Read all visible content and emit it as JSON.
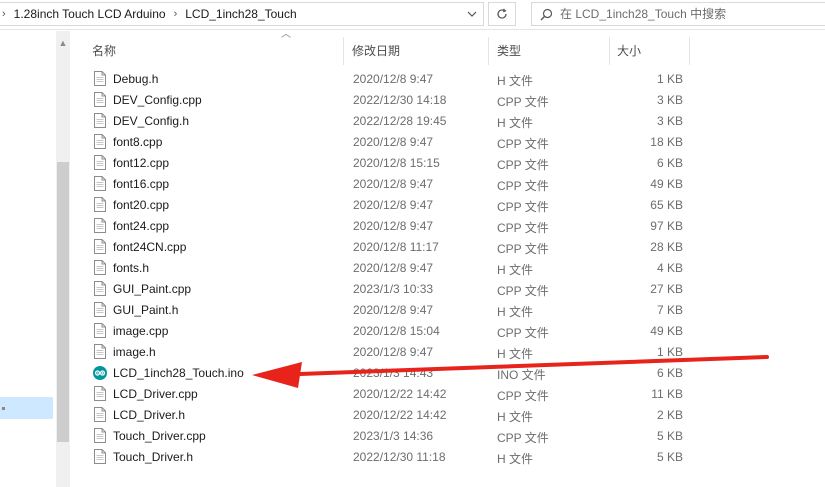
{
  "address": {
    "crumbs": [
      "1.28inch Touch LCD Arduino",
      "LCD_1inch28_Touch"
    ]
  },
  "search": {
    "placeholder": "在 LCD_1inch28_Touch 中搜索"
  },
  "columns": {
    "name": "名称",
    "modified": "修改日期",
    "type": "类型",
    "size": "大小"
  },
  "files": [
    {
      "name": "Debug.h",
      "date": "2020/12/8 9:47",
      "type": "H 文件",
      "size": "1 KB",
      "icon": "file-icon"
    },
    {
      "name": "DEV_Config.cpp",
      "date": "2022/12/30 14:18",
      "type": "CPP 文件",
      "size": "3 KB",
      "icon": "file-icon"
    },
    {
      "name": "DEV_Config.h",
      "date": "2022/12/28 19:45",
      "type": "H 文件",
      "size": "3 KB",
      "icon": "file-icon"
    },
    {
      "name": "font8.cpp",
      "date": "2020/12/8 9:47",
      "type": "CPP 文件",
      "size": "18 KB",
      "icon": "file-icon"
    },
    {
      "name": "font12.cpp",
      "date": "2020/12/8 15:15",
      "type": "CPP 文件",
      "size": "6 KB",
      "icon": "file-icon"
    },
    {
      "name": "font16.cpp",
      "date": "2020/12/8 9:47",
      "type": "CPP 文件",
      "size": "49 KB",
      "icon": "file-icon"
    },
    {
      "name": "font20.cpp",
      "date": "2020/12/8 9:47",
      "type": "CPP 文件",
      "size": "65 KB",
      "icon": "file-icon"
    },
    {
      "name": "font24.cpp",
      "date": "2020/12/8 9:47",
      "type": "CPP 文件",
      "size": "97 KB",
      "icon": "file-icon"
    },
    {
      "name": "font24CN.cpp",
      "date": "2020/12/8 11:17",
      "type": "CPP 文件",
      "size": "28 KB",
      "icon": "file-icon"
    },
    {
      "name": "fonts.h",
      "date": "2020/12/8 9:47",
      "type": "H 文件",
      "size": "4 KB",
      "icon": "file-icon"
    },
    {
      "name": "GUI_Paint.cpp",
      "date": "2023/1/3 10:33",
      "type": "CPP 文件",
      "size": "27 KB",
      "icon": "file-icon"
    },
    {
      "name": "GUI_Paint.h",
      "date": "2020/12/8 9:47",
      "type": "H 文件",
      "size": "7 KB",
      "icon": "file-icon"
    },
    {
      "name": "image.cpp",
      "date": "2020/12/8 15:04",
      "type": "CPP 文件",
      "size": "49 KB",
      "icon": "file-icon"
    },
    {
      "name": "image.h",
      "date": "2020/12/8 9:47",
      "type": "H 文件",
      "size": "1 KB",
      "icon": "file-icon"
    },
    {
      "name": "LCD_1inch28_Touch.ino",
      "date": "2023/1/3 14:43",
      "type": "INO 文件",
      "size": "6 KB",
      "icon": "arduino-icon"
    },
    {
      "name": "LCD_Driver.cpp",
      "date": "2020/12/22 14:42",
      "type": "CPP 文件",
      "size": "11 KB",
      "icon": "file-icon"
    },
    {
      "name": "LCD_Driver.h",
      "date": "2020/12/22 14:42",
      "type": "H 文件",
      "size": "2 KB",
      "icon": "file-icon"
    },
    {
      "name": "Touch_Driver.cpp",
      "date": "2023/1/3 14:36",
      "type": "CPP 文件",
      "size": "5 KB",
      "icon": "file-icon"
    },
    {
      "name": "Touch_Driver.h",
      "date": "2022/12/30 11:18",
      "type": "H 文件",
      "size": "5 KB",
      "icon": "file-icon"
    }
  ],
  "colors": {
    "arrow": "#e8231c",
    "arduino": "#00979c",
    "selection": "#cde8ff"
  }
}
